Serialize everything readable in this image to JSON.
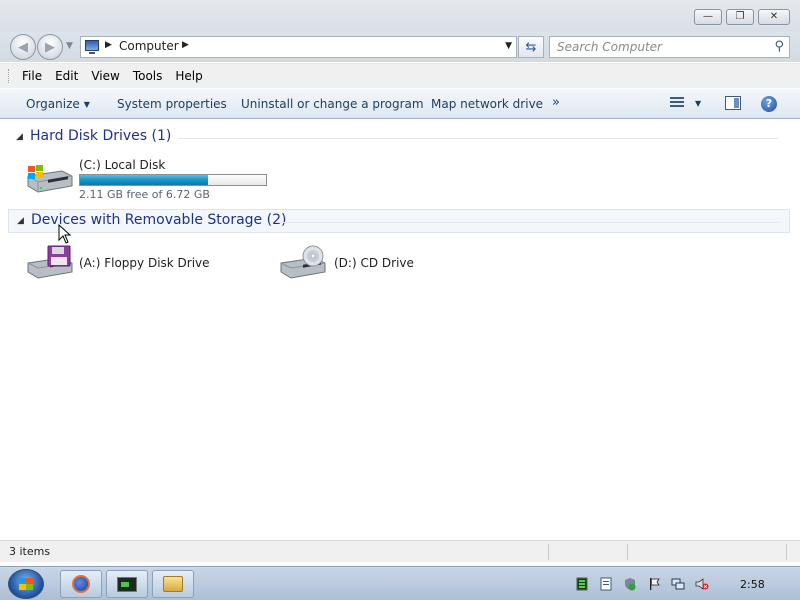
{
  "window": {
    "minimize_glyph": "—",
    "maximize_glyph": "❐",
    "close_glyph": "✕"
  },
  "address_bar": {
    "location": "Computer",
    "refresh_glyph": "⇆",
    "search_placeholder": "Search Computer"
  },
  "menu": {
    "items": [
      "File",
      "Edit",
      "View",
      "Tools",
      "Help"
    ]
  },
  "toolbar": {
    "organize": "Organize",
    "system_properties": "System properties",
    "uninstall": "Uninstall or change a program",
    "map_network_drive": "Map network drive",
    "more": "»"
  },
  "groups": {
    "hard_disk": {
      "title": "Hard Disk Drives (1)",
      "drives": [
        {
          "label": "(C:) Local Disk",
          "free_text": "2.11 GB free of 6.72 GB",
          "used_fraction": 0.686,
          "icon": "windows-hard-drive-icon"
        }
      ]
    },
    "removable": {
      "title": "Devices with Removable Storage (2)",
      "drives": [
        {
          "label": "(A:) Floppy Disk Drive",
          "icon": "floppy-drive-icon"
        },
        {
          "label": "(D:) CD Drive",
          "icon": "cd-drive-icon"
        }
      ]
    }
  },
  "status": {
    "item_count": "3 items"
  },
  "taskbar": {
    "apps": [
      "firefox-icon",
      "terminal-icon",
      "explorer-icon"
    ],
    "clock": "2:58"
  },
  "colors": {
    "capacity_bar": "#1a8fc4",
    "group_title": "#1e3287",
    "taskbar": "#b9cadf"
  }
}
